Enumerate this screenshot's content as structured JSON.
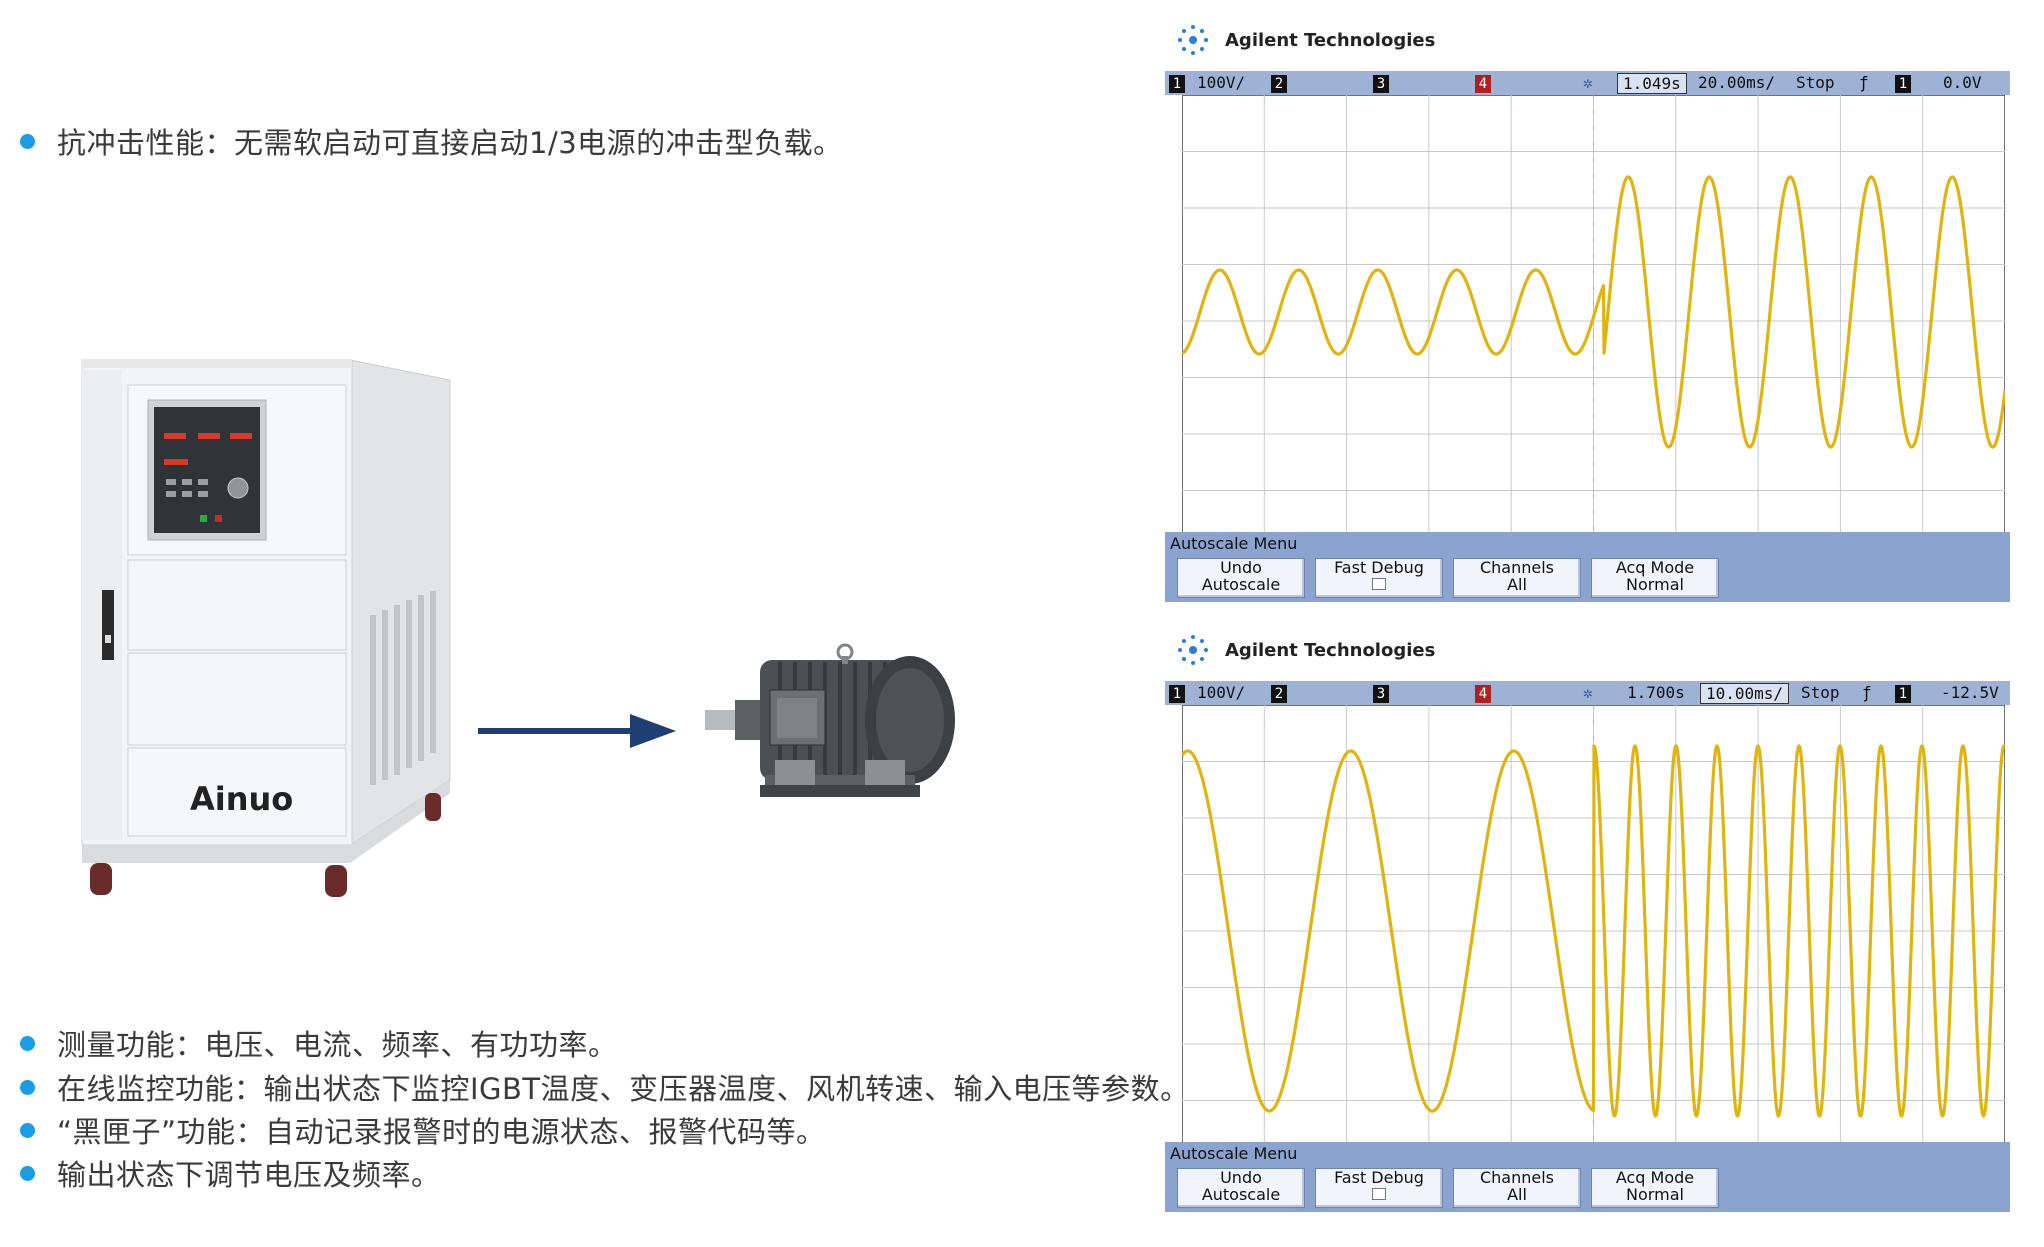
{
  "features": {
    "impact": "抗冲击性能：无需软启动可直接启动1/3电源的冲击型负载。",
    "measure": "测量功能：电压、电流、频率、有功功率。",
    "monitor": "在线监控功能：输出状态下监控IGBT温度、变压器温度、风机转速、输入电压等参数。",
    "blackbox": "“黑匣子”功能：自动记录报警时的电源状态、报警代码等。",
    "adjust": "输出状态下调节电压及频率。"
  },
  "device": {
    "brand": "Ainuo"
  },
  "colors": {
    "accent": "#1a9de6",
    "arrow": "#1e3f73",
    "trace": "#e0b40f",
    "bar": "#9eb2d6"
  },
  "scope_top": {
    "brand": "Agilent Technologies",
    "ch1_num": "1",
    "ch1_scale": "100V/",
    "ch2": "2",
    "ch3": "3",
    "ch4": "4",
    "time": "1.049s",
    "timebase": "20.00ms/",
    "state": "Stop",
    "trig_ch": "1",
    "trig_level": "0.0V",
    "menu_title": "Autoscale Menu",
    "key1_l1": "Undo",
    "key1_l2": "Autoscale",
    "key2_l1": "Fast Debug",
    "key3_l1": "Channels",
    "key3_l2": "All",
    "key4_l1": "Acq Mode",
    "key4_l2": "Normal"
  },
  "scope_bottom": {
    "brand": "Agilent Technologies",
    "ch1_num": "1",
    "ch1_scale": "100V/",
    "ch2": "2",
    "ch3": "3",
    "ch4": "4",
    "time": "1.700s",
    "timebase": "10.00ms/",
    "state": "Stop",
    "trig_ch": "1",
    "trig_level": "-12.5V",
    "menu_title": "Autoscale Menu",
    "key1_l1": "Undo",
    "key1_l2": "Autoscale",
    "key2_l1": "Fast Debug",
    "key3_l1": "Channels",
    "key3_l2": "All",
    "key4_l1": "Acq Mode",
    "key4_l2": "Normal"
  }
}
